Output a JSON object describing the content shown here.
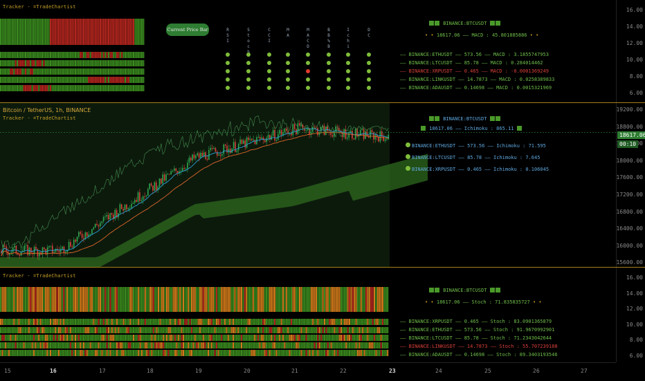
{
  "indicator_title": "Tracker - ⌗TradeChartist",
  "main_title": "Bitcoin / TetherUS, 1h, BINANCE",
  "callout": "Current Price Bar",
  "top_scale": [
    "16.00",
    "14.00",
    "12.00",
    "10.00",
    "8.00",
    "6.00"
  ],
  "main_scale": [
    "19200.00",
    "18800.00",
    "18400.00",
    "18000.00",
    "17600.00",
    "17200.00",
    "16800.00",
    "16400.00",
    "16000.00",
    "15600.00"
  ],
  "bottom_scale": [
    "16.00",
    "14.00",
    "12.00",
    "10.00",
    "8.00",
    "6.00"
  ],
  "x_axis": [
    "15",
    "16",
    "17",
    "18",
    "19",
    "20",
    "21",
    "22",
    "23",
    "24",
    "25",
    "26",
    "27"
  ],
  "price_badge": "18617.06",
  "time_badge": "00:10",
  "col_headers": [
    "RSI",
    "Stoch",
    "CCI",
    "MA",
    "MACD",
    "BB%B",
    "Ichi",
    "DC"
  ],
  "top_panel": {
    "symbol": "BINANCE:BTCUSDT",
    "line": "18617.06 —— MACD : 45.801885886",
    "rows": [
      {
        "text": "BINANCE:ETHUSDT —— 573.56 —— MACD : 3.1855747953",
        "color": "#6fbf4a"
      },
      {
        "text": "BINANCE:LTCUSDT —— 85.78 —— MACD : 0.284014462",
        "color": "#6fbf4a"
      },
      {
        "text": "BINANCE:XRPUSDT —— 0.465 —— MACD : -0.0001369249",
        "color": "#d9403a"
      },
      {
        "text": "BINANCE:LINKUSDT —— 14.7873 —— MACD : 0.0258389833",
        "color": "#6fbf4a"
      },
      {
        "text": "BINANCE:ADAUSDT —— 0.14698 —— MACD : 0.0015321969",
        "color": "#6fbf4a"
      }
    ]
  },
  "main_panel": {
    "symbol": "BINANCE:BTCUSDT",
    "line": "18617.06 —— Ichimoku : 865.11",
    "rows": [
      {
        "text": "BINANCE:ETHUSDT —— 573.56 —— Ichimoku : 71.595"
      },
      {
        "text": "BINANCE:LTCUSDT —— 85.78 —— Ichimoku : 7.645"
      },
      {
        "text": "BINANCE:XRPUSDT —— 0.465 —— Ichimoku : 0.106045"
      }
    ]
  },
  "bottom_panel": {
    "symbol": "BINANCE:BTCUSDT",
    "line": "18617.06 —— Stoch : 71.835835727",
    "rows": [
      {
        "text": "BINANCE:XRPUSDT —— 0.465 —— Stoch : 83.0901365879",
        "color": "#6fbf4a"
      },
      {
        "text": "BINANCE:ETHUSDT —— 573.56 —— Stoch : 91.9670992901",
        "color": "#6fbf4a"
      },
      {
        "text": "BINANCE:LTCUSDT —— 85.78 —— Stoch : 71.2343042644",
        "color": "#6fbf4a"
      },
      {
        "text": "BINANCE:LINKUSDT —— 14.7873 —— Stoch : 55.707239188",
        "color": "#d9403a"
      },
      {
        "text": "BINANCE:ADAUSDT —— 0.14698 —— Stoch : 89.3403193546",
        "color": "#6fbf4a"
      }
    ]
  },
  "dot_states": [
    [
      "g",
      "g",
      "g",
      "g",
      "g",
      "g",
      "g",
      "g"
    ],
    [
      "g",
      "g",
      "g",
      "g",
      "g",
      "g",
      "g",
      "g"
    ],
    [
      "g",
      "g",
      "g",
      "g",
      "r",
      "g",
      "g",
      "g"
    ],
    [
      "g",
      "g",
      "g",
      "g",
      "g",
      "g",
      "g",
      "g"
    ],
    [
      "g",
      "g",
      "g",
      "g",
      "g",
      "g",
      "g",
      "g"
    ]
  ],
  "colors": {
    "bull": "#3a8a1e",
    "bear": "#b3261e",
    "neutral": "#d07a1a",
    "accent": "#c8961c",
    "cloud": "#2e6a1e"
  }
}
